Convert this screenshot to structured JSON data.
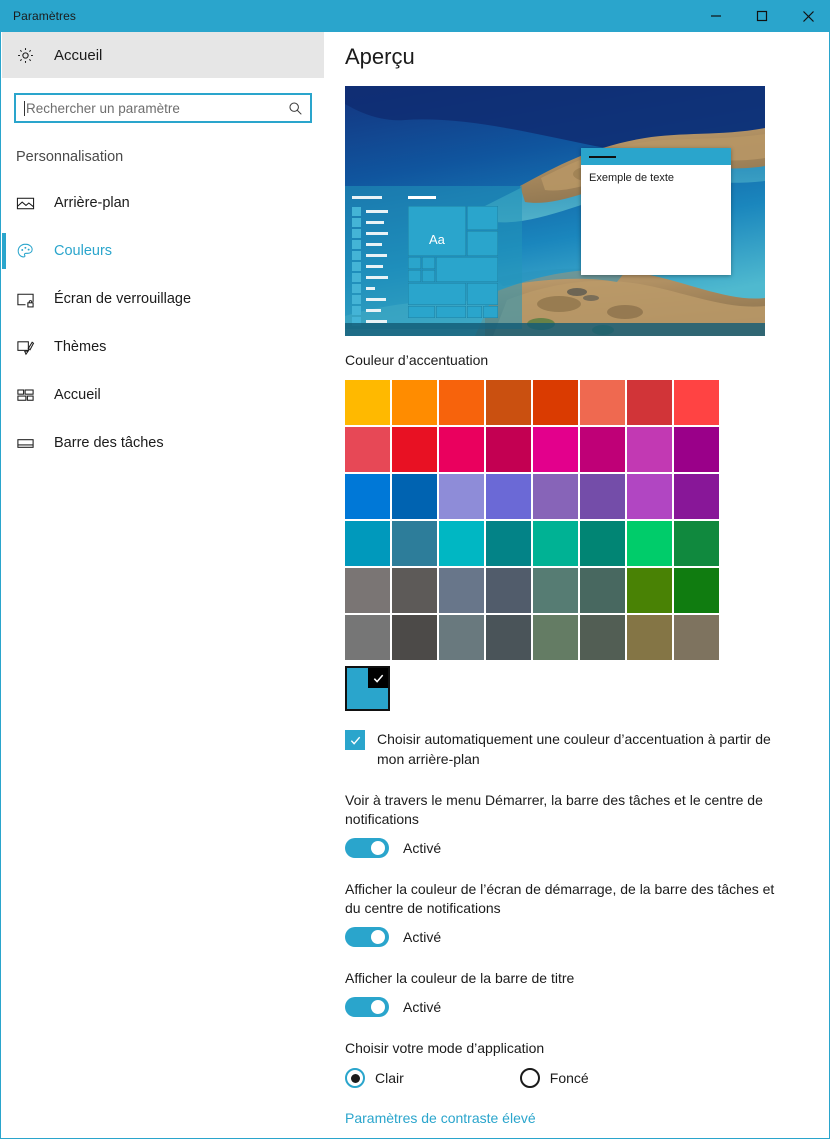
{
  "window": {
    "title": "Paramètres",
    "accent_color": "#2AA5CC",
    "controls": [
      {
        "name": "minimize",
        "glyph": "minimize-icon"
      },
      {
        "name": "maximize",
        "glyph": "maximize-icon"
      },
      {
        "name": "close",
        "glyph": "close-icon"
      }
    ]
  },
  "sidebar": {
    "home": {
      "label": "Accueil",
      "icon": "gear-icon"
    },
    "search": {
      "placeholder": "Rechercher un paramètre",
      "value": "",
      "icon": "search-icon"
    },
    "section_heading": "Personnalisation",
    "items": [
      {
        "label": "Arrière-plan",
        "icon": "picture-icon",
        "selected": false
      },
      {
        "label": "Couleurs",
        "icon": "palette-icon",
        "selected": true
      },
      {
        "label": "Écran de verrouillage",
        "icon": "lockscreen-icon",
        "selected": false
      },
      {
        "label": "Thèmes",
        "icon": "brush-icon",
        "selected": false
      },
      {
        "label": "Accueil",
        "icon": "startmenu-icon",
        "selected": false
      },
      {
        "label": "Barre des tâches",
        "icon": "taskbar-icon",
        "selected": false
      }
    ]
  },
  "main": {
    "title": "Aperçu",
    "preview": {
      "sample_text": "Exemple de texte",
      "tile_text": "Aa",
      "accent_color": "#2AA5CC"
    },
    "accent_section": {
      "label": "Couleur d’accentuation",
      "selected_color": "#2AA5CC",
      "colors": [
        "#FFB900",
        "#FF8C00",
        "#F7630C",
        "#CA5010",
        "#DA3B01",
        "#EF6950",
        "#D13438",
        "#FF4343",
        "#E74856",
        "#E81123",
        "#EA005E",
        "#C30052",
        "#E3008C",
        "#BF0077",
        "#C239B3",
        "#9A0089",
        "#0078D7",
        "#0063B1",
        "#8E8CD8",
        "#6B69D6",
        "#8764B8",
        "#744DA9",
        "#B146C2",
        "#881798",
        "#0099BC",
        "#2D7D9A",
        "#00B7C3",
        "#038387",
        "#00B294",
        "#018574",
        "#00CC6A",
        "#10893E",
        "#7A7574",
        "#5D5A58",
        "#68768A",
        "#515C6B",
        "#567C73",
        "#486860",
        "#498205",
        "#107C10",
        "#767676",
        "#4C4A48",
        "#69797E",
        "#4A5459",
        "#647C64",
        "#525E54",
        "#847545",
        "#7E735F"
      ]
    },
    "auto_accent": {
      "label": "Choisir automatiquement une couleur d’accentuation à partir de mon arrière-plan",
      "checked": true
    },
    "toggles": [
      {
        "description": "Voir à travers le menu Démarrer, la barre des tâches et le centre de notifications",
        "state_label": "Activé",
        "on": true
      },
      {
        "description": "Afficher la couleur de l’écran de démarrage, de la barre des tâches et du centre de notifications",
        "state_label": "Activé",
        "on": true
      },
      {
        "description": "Afficher la couleur de la barre de titre",
        "state_label": "Activé",
        "on": true
      }
    ],
    "app_mode": {
      "label": "Choisir votre mode d’application",
      "options": [
        {
          "label": "Clair",
          "selected": true
        },
        {
          "label": "Foncé",
          "selected": false
        }
      ]
    },
    "link": "Paramètres de contraste élevé"
  }
}
